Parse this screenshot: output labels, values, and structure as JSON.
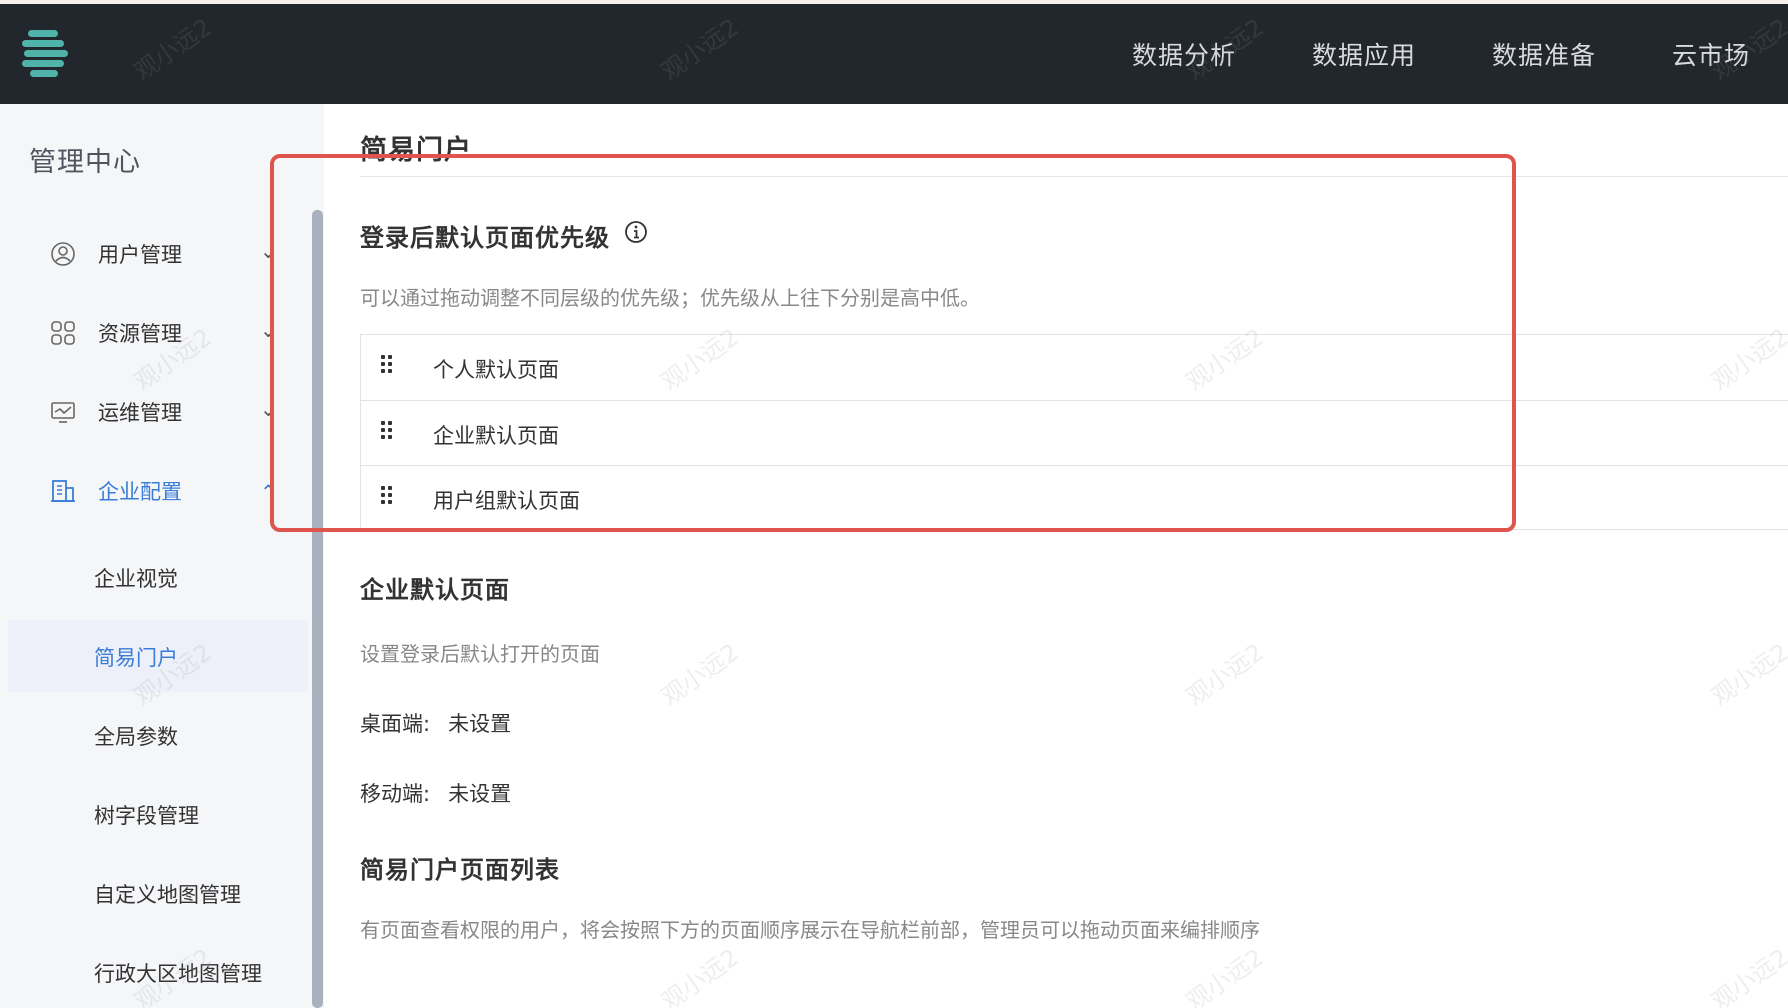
{
  "header": {
    "nav": [
      {
        "label": "数据分析"
      },
      {
        "label": "数据应用"
      },
      {
        "label": "数据准备"
      },
      {
        "label": "云市场"
      }
    ]
  },
  "sidebar": {
    "title": "管理中心",
    "groups": [
      {
        "label": "用户管理",
        "icon": "user-circle-icon",
        "expanded": false
      },
      {
        "label": "资源管理",
        "icon": "grid-icon",
        "expanded": false
      },
      {
        "label": "运维管理",
        "icon": "monitor-icon",
        "expanded": false
      },
      {
        "label": "企业配置",
        "icon": "building-icon",
        "expanded": true
      }
    ],
    "subitems": [
      {
        "label": "企业视觉"
      },
      {
        "label": "简易门户",
        "current": true
      },
      {
        "label": "全局参数"
      },
      {
        "label": "树字段管理"
      },
      {
        "label": "自定义地图管理"
      },
      {
        "label": "行政大区地图管理"
      }
    ]
  },
  "main": {
    "page_title": "简易门户",
    "priority": {
      "title": "登录后默认页面优先级",
      "description": "可以通过拖动调整不同层级的优先级；优先级从上往下分别是高中低。",
      "items": [
        {
          "label": "个人默认页面"
        },
        {
          "label": "企业默认页面"
        },
        {
          "label": "用户组默认页面"
        }
      ]
    },
    "enterprise_default": {
      "title": "企业默认页面",
      "description": "设置登录后默认打开的页面",
      "desktop_label": "桌面端:",
      "desktop_value": "未设置",
      "mobile_label": "移动端:",
      "mobile_value": "未设置"
    },
    "page_list": {
      "title": "简易门户页面列表",
      "description": "有页面查看权限的用户，将会按照下方的页面顺序展示在导航栏前部，管理员可以拖动页面来编排顺序"
    }
  },
  "watermark": "观小远2",
  "colors": {
    "topbar": "#22272d",
    "accent": "#3a7dd8",
    "highlight": "#e0544e",
    "logo": "#4fb3a9"
  }
}
